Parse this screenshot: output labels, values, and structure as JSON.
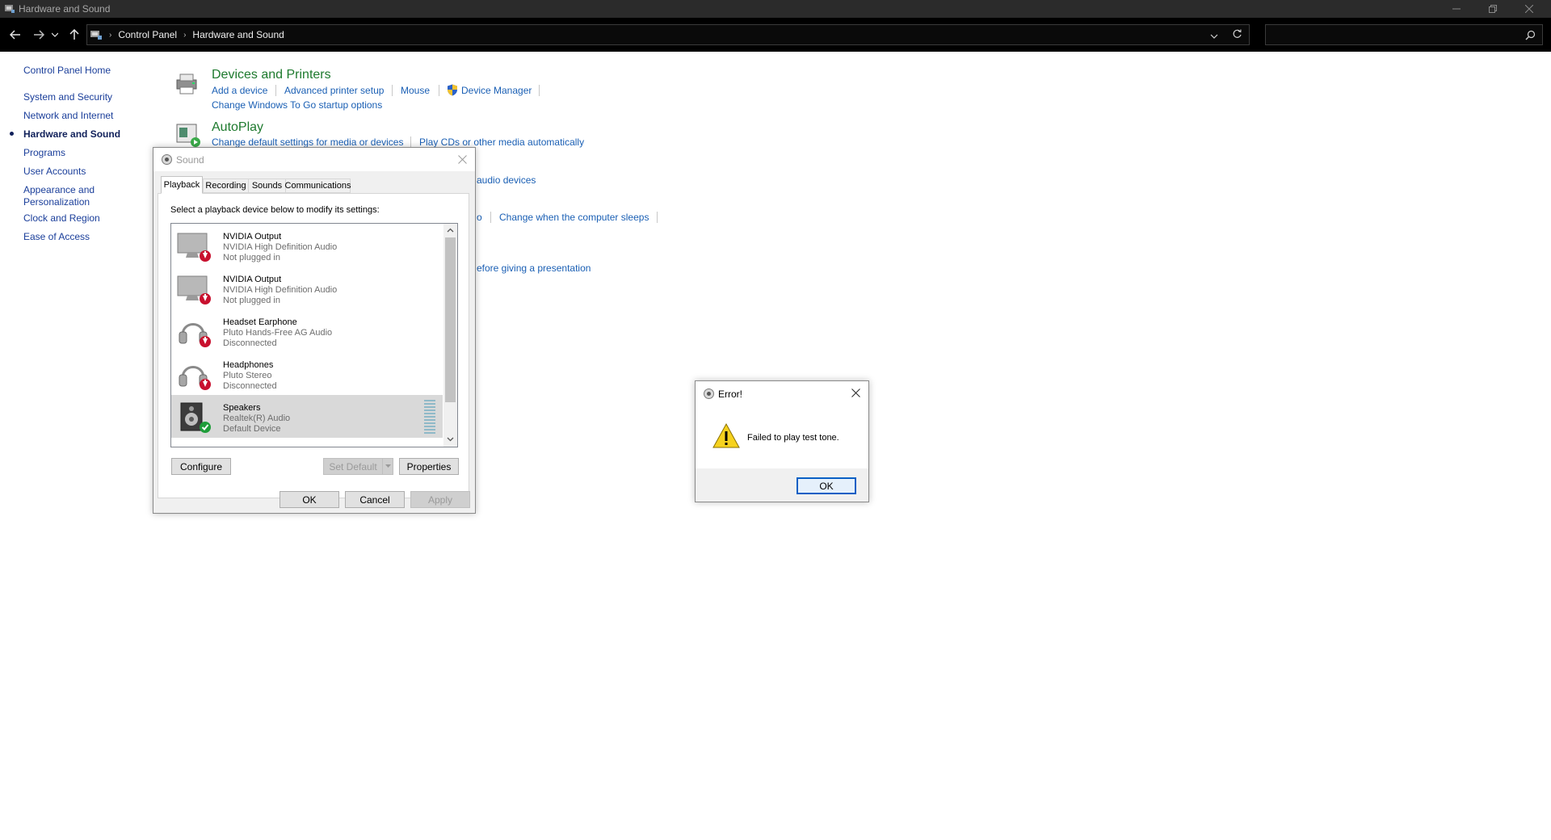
{
  "window": {
    "title": "Hardware and Sound"
  },
  "breadcrumb": {
    "root": "Control Panel",
    "current": "Hardware and Sound"
  },
  "leftnav": {
    "items": [
      {
        "label": "Control Panel Home"
      },
      {
        "label": "System and Security"
      },
      {
        "label": "Network and Internet"
      },
      {
        "label": "Hardware and Sound"
      },
      {
        "label": "Programs"
      },
      {
        "label": "User Accounts"
      },
      {
        "label": "Appearance and Personalization"
      },
      {
        "label": "Clock and Region"
      },
      {
        "label": "Ease of Access"
      }
    ]
  },
  "devices_printers": {
    "title": "Devices and Printers",
    "links": [
      "Add a device",
      "Advanced printer setup",
      "Mouse",
      "Device Manager"
    ],
    "link2": "Change Windows To Go startup options"
  },
  "autoplay": {
    "title": "AutoPlay",
    "links": [
      "Change default settings for media or devices",
      "Play CDs or other media automatically"
    ]
  },
  "partial_links": {
    "audio": "audio devices",
    "o": "o",
    "sleep": "Change when the computer sleeps",
    "presentation": "efore giving a presentation"
  },
  "sound_dialog": {
    "title": "Sound",
    "tabs": [
      "Playback",
      "Recording",
      "Sounds",
      "Communications"
    ],
    "instruction": "Select a playback device below to modify its settings:",
    "devices": [
      {
        "name": "NVIDIA Output",
        "driver": "NVIDIA High Definition Audio",
        "status": "Not plugged in"
      },
      {
        "name": "NVIDIA Output",
        "driver": "NVIDIA High Definition Audio",
        "status": "Not plugged in"
      },
      {
        "name": "Headset Earphone",
        "driver": "Pluto Hands-Free AG Audio",
        "status": "Disconnected"
      },
      {
        "name": "Headphones",
        "driver": "Pluto Stereo",
        "status": "Disconnected"
      },
      {
        "name": "Speakers",
        "driver": "Realtek(R) Audio",
        "status": "Default Device"
      }
    ],
    "buttons": {
      "configure": "Configure",
      "set_default": "Set Default",
      "properties": "Properties",
      "ok": "OK",
      "cancel": "Cancel",
      "apply": "Apply"
    }
  },
  "error_dialog": {
    "title": "Error!",
    "message": "Failed to play test tone.",
    "ok": "OK"
  }
}
